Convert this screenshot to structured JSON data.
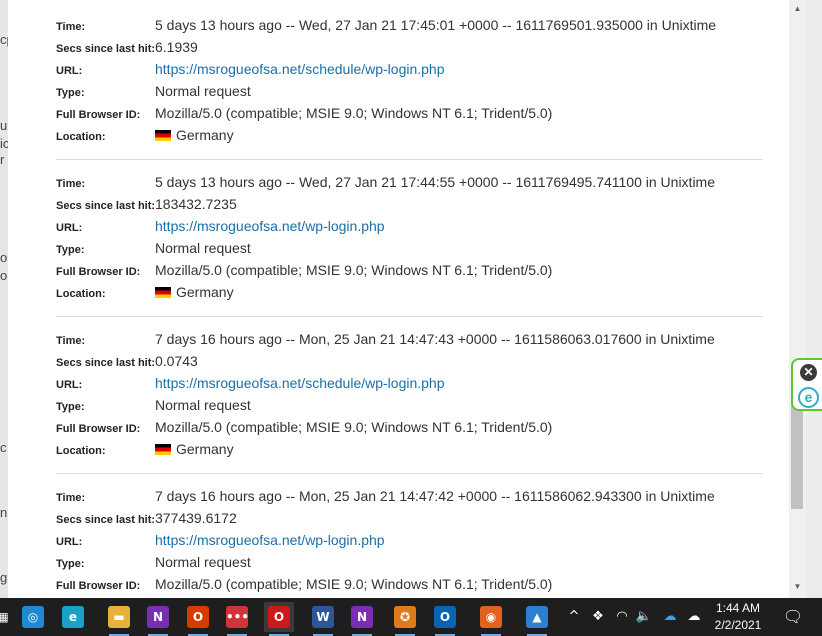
{
  "labels": {
    "time": "Time:",
    "secs": "Secs since last hit:",
    "url": "URL:",
    "type": "Type:",
    "browser": "Full Browser ID:",
    "location": "Location:"
  },
  "entries": [
    {
      "time": "5 days 13 hours ago -- Wed, 27 Jan 21 17:45:01 +0000 -- 1611769501.935000 in Unixtime",
      "secs": "6.1939",
      "url": "https://msrogueofsa.net/schedule/wp-login.php",
      "type": "Normal request",
      "browser": "Mozilla/5.0 (compatible; MSIE 9.0; Windows NT 6.1; Trident/5.0)",
      "location": "Germany"
    },
    {
      "time": "5 days 13 hours ago -- Wed, 27 Jan 21 17:44:55 +0000 -- 1611769495.741100 in Unixtime",
      "secs": "183432.7235",
      "url": "https://msrogueofsa.net/wp-login.php",
      "type": "Normal request",
      "browser": "Mozilla/5.0 (compatible; MSIE 9.0; Windows NT 6.1; Trident/5.0)",
      "location": "Germany"
    },
    {
      "time": "7 days 16 hours ago -- Mon, 25 Jan 21 14:47:43 +0000 -- 1611586063.017600 in Unixtime",
      "secs": "0.0743",
      "url": "https://msrogueofsa.net/schedule/wp-login.php",
      "type": "Normal request",
      "browser": "Mozilla/5.0 (compatible; MSIE 9.0; Windows NT 6.1; Trident/5.0)",
      "location": "Germany"
    },
    {
      "time": "7 days 16 hours ago -- Mon, 25 Jan 21 14:47:42 +0000 -- 1611586062.943300 in Unixtime",
      "secs": "377439.6172",
      "url": "https://msrogueofsa.net/wp-login.php",
      "type": "Normal request",
      "browser": "Mozilla/5.0 (compatible; MSIE 9.0; Windows NT 6.1; Trident/5.0)",
      "location": ""
    }
  ],
  "left_fragments": [
    "cp",
    "u",
    "ic",
    "r",
    "o",
    "or",
    "c",
    "n",
    "g"
  ],
  "eset": {
    "close_glyph": "✕",
    "logo_letter": "e"
  },
  "taskbar": {
    "apps": [
      {
        "name": "start-icon",
        "glyph": "▦",
        "color": "#1e1e1e"
      },
      {
        "name": "cortana-app-icon",
        "glyph": "◎",
        "color": "#1f8ad2"
      },
      {
        "name": "edge-app-icon",
        "glyph": "e",
        "color": "#1aa1c7"
      },
      {
        "name": "file-explorer-icon",
        "glyph": "▬",
        "color": "#e8b23a"
      },
      {
        "name": "onenote-app-icon",
        "glyph": "N",
        "color": "#7a2fb0"
      },
      {
        "name": "office-app-icon",
        "glyph": "O",
        "color": "#d83b01"
      },
      {
        "name": "remote-app-icon",
        "glyph": "•••",
        "color": "#d13438"
      },
      {
        "name": "opera-app-icon",
        "glyph": "O",
        "color": "#cc1a1a"
      },
      {
        "name": "word-app-icon",
        "glyph": "W",
        "color": "#2b579a"
      },
      {
        "name": "onenote-app-icon-2",
        "glyph": "N",
        "color": "#7a2fb0"
      },
      {
        "name": "vpn-app-icon",
        "glyph": "✪",
        "color": "#e07b1a"
      },
      {
        "name": "outlook-app-icon",
        "glyph": "O",
        "color": "#0a64b4"
      },
      {
        "name": "firefox-app-icon",
        "glyph": "◉",
        "color": "#e2611e"
      },
      {
        "name": "photos-app-icon",
        "glyph": "▲",
        "color": "#2d7fd0"
      }
    ],
    "tray": {
      "chevron": "^",
      "dropbox": "❖",
      "wifi": "◠",
      "volume": "🔈",
      "onedrive": "☁",
      "cloud": "☁"
    },
    "time": "1:44 AM",
    "date": "2/2/2021",
    "notification_glyph": "🗨"
  },
  "scrollbar": {
    "up": "▲",
    "down": "▼"
  }
}
